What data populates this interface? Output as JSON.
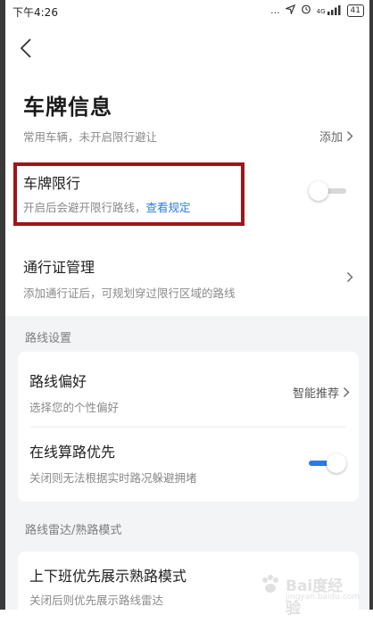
{
  "status_bar": {
    "time": "下午4:26",
    "dots": "...",
    "network": "4G",
    "battery": "41"
  },
  "page": {
    "title": "车牌信息"
  },
  "plate": {
    "desc": "常用车辆，未开启限行避让",
    "add_label": "添加"
  },
  "restriction": {
    "title": "车牌限行",
    "desc": "开启后会避开限行路线，",
    "link": "查看规定",
    "enabled": false
  },
  "pass": {
    "title": "通行证管理",
    "desc": "添加通行证后，可规划穿过限行区域的路线"
  },
  "route_settings": {
    "section_label": "路线设置",
    "preference": {
      "title": "路线偏好",
      "desc": "选择您的个性偏好",
      "value": "智能推荐"
    },
    "online": {
      "title": "在线算路优先",
      "desc": "关闭则无法根据实时路况躲避拥堵",
      "enabled": true
    }
  },
  "radar": {
    "section_label": "路线雷达/熟路模式",
    "commute": {
      "title": "上下班优先展示熟路模式",
      "desc": "关闭后则优先展示路线雷达"
    }
  },
  "watermark": {
    "text": "Bai度经验",
    "sub": "jingyan.baidu.com"
  },
  "colors": {
    "accent": "#2f7ae0",
    "highlight_border": "#a0141a",
    "section_bg": "#f3f4f6"
  }
}
